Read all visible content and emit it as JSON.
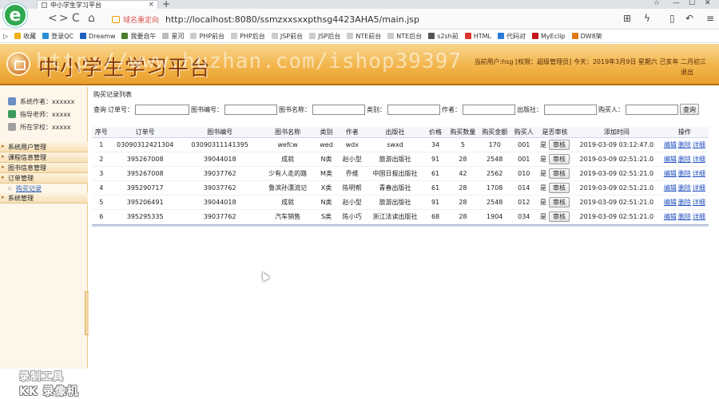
{
  "browser": {
    "tab_title": "中小学生学习平台",
    "tab_close": "×",
    "new_tab": "+",
    "nav_back": "<",
    "nav_forward": ">",
    "nav_reload": "C",
    "nav_home": "⌂",
    "secure_label": "域名重定向",
    "url": "http://localhost:8080/ssmzxxsxxpthsg4423AHA5/main.jsp",
    "menu_icon": "≡",
    "bookmarks": [
      {
        "label": "收藏",
        "color": "#f2b01e"
      },
      {
        "label": "登录QC",
        "color": "#2a8fd6"
      },
      {
        "label": "Dreamw",
        "color": "#1e5fbf"
      },
      {
        "label": "我要自午",
        "color": "#4a7d2a"
      },
      {
        "label": "星河",
        "color": "#bbbbbb"
      },
      {
        "label": "PHP前台",
        "color": "#cccccc"
      },
      {
        "label": "PHP后台",
        "color": "#cccccc"
      },
      {
        "label": "JSP前台",
        "color": "#cccccc"
      },
      {
        "label": "JSP后台",
        "color": "#cccccc"
      },
      {
        "label": "NTE前台",
        "color": "#cccccc"
      },
      {
        "label": "NTE后台",
        "color": "#cccccc"
      },
      {
        "label": "s2sh前",
        "color": "#555555"
      },
      {
        "label": "HTML",
        "color": "#d9352b"
      },
      {
        "label": "代码对",
        "color": "#2b7bd9"
      },
      {
        "label": "MyEclip",
        "color": "#c4161c"
      },
      {
        "label": "DW8架",
        "color": "#e07a10"
      }
    ]
  },
  "header": {
    "app_title": "中小学生学习平台",
    "watermark": "http://www.huzhan.com/ishop39397",
    "user_line": "当前用户:hsg [权限：超级管理员] 今天：2019年3月9日 星期六 己亥年 二月初三",
    "logout": "退出"
  },
  "sidebar": {
    "info": [
      {
        "label": "系统作者：xxxxxx",
        "icon": "user-icon",
        "color": "#6a8fc4"
      },
      {
        "label": "指导老师：xxxxx",
        "icon": "teacher-icon",
        "color": "#3a9a5a"
      },
      {
        "label": "所在学校：xxxxx",
        "icon": "school-icon",
        "color": "#a0a0a0"
      }
    ],
    "menu": [
      {
        "label": "系统用户管理",
        "type": "group"
      },
      {
        "label": "课程信息管理",
        "type": "group"
      },
      {
        "label": "图书信息管理",
        "type": "group"
      },
      {
        "label": "订单管理",
        "type": "group"
      },
      {
        "label": "购买记录",
        "type": "sub"
      },
      {
        "label": "系统管理",
        "type": "group"
      }
    ],
    "recorder_line1": "录制工具",
    "recorder_line2": "KK 录像机"
  },
  "main": {
    "section_title": "购买记录列表",
    "filter": {
      "prefix": "查询",
      "fields": [
        {
          "label": "订单号："
        },
        {
          "label": "图书编号："
        },
        {
          "label": "图书名称："
        },
        {
          "label": "类别："
        },
        {
          "label": "作者："
        },
        {
          "label": "出版社："
        },
        {
          "label": "购买人："
        }
      ],
      "search_button": "查询"
    },
    "columns": [
      "序号",
      "订单号",
      "图书编号",
      "图书名称",
      "类别",
      "作者",
      "出版社",
      "价格",
      "购买数量",
      "购买金额",
      "购买人",
      "是否审核",
      "添加时间",
      "操作"
    ],
    "review_button": "审核",
    "ops": [
      "编辑",
      "删除",
      "详细"
    ],
    "rows": [
      [
        "1",
        "03090312421304",
        "03090311141395",
        "wefcw",
        "wed",
        "wdx",
        "swxd",
        "34",
        "5",
        "170",
        "001",
        "是",
        "2019-03-09 03:12:47.0"
      ],
      [
        "2",
        "395267008",
        "39044018",
        "成就",
        "N类",
        "赵小型",
        "旅游出版社",
        "91",
        "28",
        "2548",
        "001",
        "是",
        "2019-03-09 02:51:21.0"
      ],
      [
        "3",
        "395267008",
        "39037762",
        "少有人走的路",
        "M类",
        "乔维",
        "中国日报出版社",
        "61",
        "42",
        "2562",
        "010",
        "是",
        "2019-03-09 02:51:21.0"
      ],
      [
        "4",
        "395290717",
        "39037762",
        "鲁滨孙漂流记",
        "X类",
        "陈明帮",
        "青春出版社",
        "61",
        "28",
        "1708",
        "014",
        "是",
        "2019-03-09 02:51:21.0"
      ],
      [
        "5",
        "395206491",
        "39044018",
        "成就",
        "N类",
        "赵小型",
        "旅游出版社",
        "91",
        "28",
        "2548",
        "012",
        "是",
        "2019-03-09 02:51:21.0"
      ],
      [
        "6",
        "395295335",
        "39037762",
        "汽车销售",
        "S类",
        "陈小巧",
        "浙江法读出版社",
        "68",
        "28",
        "1904",
        "034",
        "是",
        "2019-03-09 02:51:21.0"
      ]
    ]
  }
}
